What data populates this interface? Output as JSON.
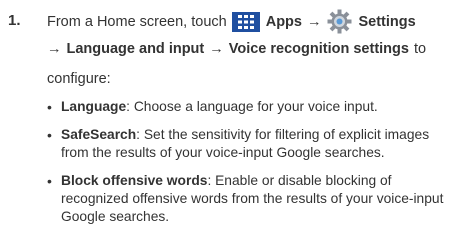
{
  "step": {
    "number": "1.",
    "line1": {
      "pre": "From a Home screen, touch",
      "apps_label": "Apps",
      "arrow1": "→",
      "settings_label": "Settings"
    },
    "line2": {
      "arrow": "→",
      "lang_input": "Language and input",
      "arrow2": "→",
      "voice_settings": "Voice recognition settings",
      "post": "to"
    },
    "line3": "configure:"
  },
  "bullets": [
    {
      "term": "Language",
      "desc": ": Choose a language for your voice input."
    },
    {
      "term": "SafeSearch",
      "desc": ": Set the sensitivity for filtering of explicit images from the results of your voice-input Google searches."
    },
    {
      "term": "Block offensive words",
      "desc": ": Enable or disable blocking of recognized offensive words from the results of your voice-input Google searches."
    }
  ],
  "icons": {
    "apps": "apps-icon",
    "settings": "settings-icon"
  }
}
